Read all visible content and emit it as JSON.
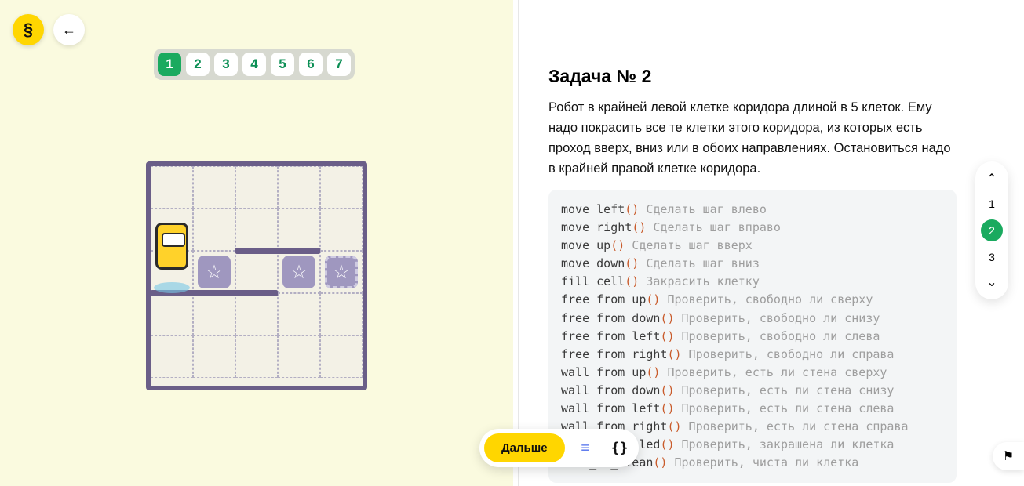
{
  "logo_glyph": "§",
  "back_arrow": "←",
  "steps": [
    "1",
    "2",
    "3",
    "4",
    "5",
    "6",
    "7"
  ],
  "active_step_index": 0,
  "task": {
    "title": "Задача № 2",
    "description": "Робот в крайней левой клетке коридора длиной в 5 клеток. Ему надо покрасить все те клетки этого коридора, из которых есть проход вверх, вниз или в обоих направлениях. Остановиться надо в крайней правой клетке коридора."
  },
  "api": [
    {
      "fn": "move_left",
      "cmt": "Сделать шаг влево"
    },
    {
      "fn": "move_right",
      "cmt": "Сделать шаг вправо"
    },
    {
      "fn": "move_up",
      "cmt": "Сделать шаг вверх"
    },
    {
      "fn": "move_down",
      "cmt": "Сделать шаг вниз"
    },
    {
      "fn": "fill_cell",
      "cmt": "Закрасить клетку"
    },
    {
      "fn": "free_from_up",
      "cmt": "Проверить, свободно ли сверху"
    },
    {
      "fn": "free_from_down",
      "cmt": "Проверить, свободно ли снизу"
    },
    {
      "fn": "free_from_left",
      "cmt": "Проверить, свободно ли слева"
    },
    {
      "fn": "free_from_right",
      "cmt": "Проверить, свободно ли справа"
    },
    {
      "fn": "wall_from_up",
      "cmt": "Проверить, есть ли стена сверху"
    },
    {
      "fn": "wall_from_down",
      "cmt": "Проверить, есть ли стена снизу"
    },
    {
      "fn": "wall_from_left",
      "cmt": "Проверить, есть ли стена слева"
    },
    {
      "fn": "wall_from_right",
      "cmt": "Проверить, есть ли стена справа"
    },
    {
      "fn": "cell_is_filled",
      "cmt": "Проверить, закрашена ли клетка"
    },
    {
      "fn": "cell_is_clean",
      "cmt": "Проверить, чиста ли клетка"
    }
  ],
  "next_label": "Дальше",
  "text_icon": "≡",
  "code_icon": "{}",
  "side_nav": {
    "up": "⌃",
    "down": "⌄",
    "items": [
      "1",
      "2",
      "3"
    ],
    "active_index": 1
  },
  "flag_glyph": "⚑",
  "board": {
    "robot": {
      "col": 0,
      "row": 1
    },
    "stars": [
      {
        "col": 1,
        "row": 2,
        "dashed": false
      },
      {
        "col": 3,
        "row": 2,
        "dashed": false
      },
      {
        "col": 4,
        "row": 2,
        "dashed": true
      }
    ],
    "walls": [
      {
        "col_start": 2,
        "col_end": 3,
        "row_edge": 2,
        "side": "top"
      },
      {
        "col_start": 0,
        "col_end": 2,
        "row_edge": 3,
        "side": "top"
      }
    ]
  }
}
